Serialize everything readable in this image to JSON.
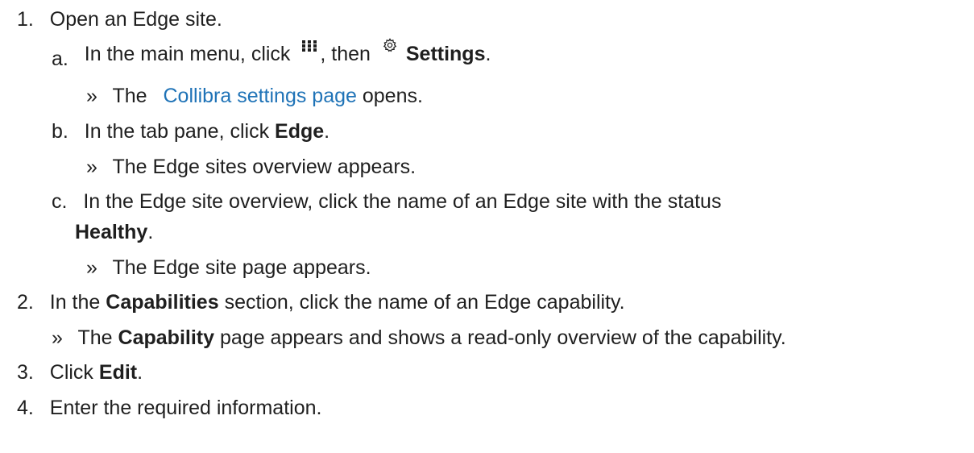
{
  "steps": [
    {
      "number": "1.",
      "text": "Open an Edge site.",
      "substeps": [
        {
          "letter": "a.",
          "text_before": "In the main menu, click",
          "icon1": "apps-grid-icon",
          "text_middle": ", then",
          "icon2": "gear-icon",
          "bold": "Settings",
          "text_after": ".",
          "result": {
            "bullet": "»",
            "text_before": "The",
            "link": "Collibra settings page",
            "text_after": "opens."
          }
        },
        {
          "letter": "b.",
          "text_before": "In the tab pane, click",
          "bold": "Edge",
          "text_after": ".",
          "result": {
            "bullet": "»",
            "text": "The Edge sites overview appears."
          }
        },
        {
          "letter": "c.",
          "text_before": "In the Edge site overview, click the name of an Edge site with the status",
          "bold": "Healthy",
          "text_after": ".",
          "result": {
            "bullet": "»",
            "text": "The Edge site page appears."
          }
        }
      ]
    },
    {
      "number": "2.",
      "text_before": "In the",
      "bold": "Capabilities",
      "text_after": "section, click the name of an Edge capability.",
      "result": {
        "bullet": "»",
        "text_before": "The",
        "bold": "Capability",
        "text_after": "page appears and shows a read-only overview of the capability."
      }
    },
    {
      "number": "3.",
      "text_before": "Click",
      "bold": "Edit",
      "text_after": "."
    },
    {
      "number": "4.",
      "text": "Enter the required information."
    }
  ],
  "colors": {
    "text": "#1f1f1f",
    "link": "#1f73b7"
  }
}
